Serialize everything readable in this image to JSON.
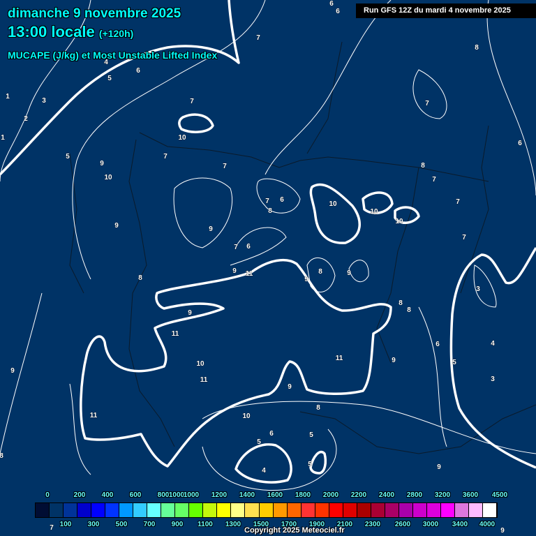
{
  "header": {
    "date": "dimanche 9 novembre 2025",
    "time": "13:00 locale",
    "lead": "(+120h)",
    "parameter": "MUCAPE (J/kg) et Most Unstable Lifted Index",
    "run": "Run GFS 12Z du mardi 4 novembre 2025"
  },
  "colors": {
    "background": "#003366",
    "contour": "#ffffff",
    "title": "#00ffff",
    "legend_text": "#66ffff"
  },
  "legend": {
    "top_labels": [
      "0",
      "200",
      "400",
      "600",
      "800",
      "1000",
      "1000",
      "1200",
      "1400",
      "1600",
      "1800",
      "2000",
      "2200",
      "2400",
      "2800",
      "3200",
      "3600",
      "4500"
    ],
    "bottom_labels": [
      "100",
      "300",
      "500",
      "700",
      "900",
      "1100",
      "1300",
      "1500",
      "1700",
      "1900",
      "2100",
      "2300",
      "2600",
      "3000",
      "3400",
      "4000"
    ],
    "colors": [
      "#000d33",
      "#003366",
      "#003399",
      "#0000cc",
      "#0000ff",
      "#0033ff",
      "#0099ff",
      "#33ccff",
      "#66ffff",
      "#66ff99",
      "#66ff66",
      "#66ff00",
      "#c4f70c",
      "#ffff00",
      "#ffff88",
      "#ffe050",
      "#ffcc00",
      "#ff9900",
      "#ff6600",
      "#ff3333",
      "#ff3300",
      "#ff0000",
      "#e00000",
      "#aa0000",
      "#aa0033",
      "#aa0066",
      "#aa00aa",
      "#cc00cc",
      "#dd00dd",
      "#ff00ff",
      "#dd77dd",
      "#ffbbff",
      "#ffffff"
    ]
  },
  "contour_labels": [
    "6",
    "6",
    "7",
    "8",
    "6",
    "5",
    "4",
    "3",
    "1",
    "2",
    "1",
    "5",
    "7",
    "7",
    "10",
    "7",
    "7",
    "9",
    "10",
    "6",
    "8",
    "7",
    "7",
    "6",
    "7",
    "8",
    "10",
    "10",
    "10",
    "9",
    "9",
    "7",
    "6",
    "7",
    "9",
    "11",
    "8",
    "9",
    "9",
    "8",
    "3",
    "8",
    "8",
    "9",
    "11",
    "6",
    "4",
    "9",
    "11",
    "5",
    "10",
    "9",
    "11",
    "3",
    "9",
    "8",
    "11",
    "10",
    "6",
    "5",
    "5",
    "5",
    "9",
    "4",
    "8",
    "7",
    "9"
  ],
  "footer": {
    "copyright": "Copyright 2025 Meteociel.fr"
  }
}
